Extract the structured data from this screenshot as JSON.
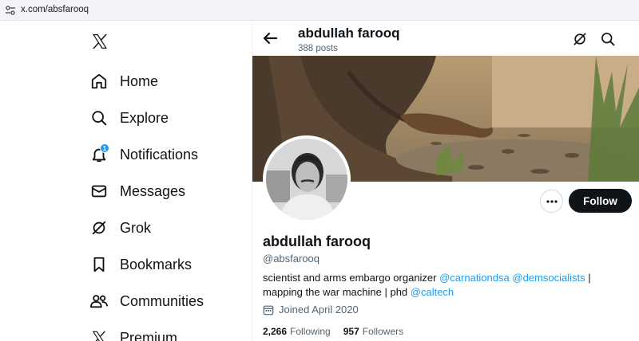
{
  "browser": {
    "url": "x.com/absfarooq"
  },
  "nav": {
    "items": [
      {
        "label": "Home",
        "icon": "home-icon"
      },
      {
        "label": "Explore",
        "icon": "search-icon"
      },
      {
        "label": "Notifications",
        "icon": "bell-icon",
        "badge": "1"
      },
      {
        "label": "Messages",
        "icon": "envelope-icon"
      },
      {
        "label": "Grok",
        "icon": "grok-icon"
      },
      {
        "label": "Bookmarks",
        "icon": "bookmark-icon"
      },
      {
        "label": "Communities",
        "icon": "people-icon"
      },
      {
        "label": "Premium",
        "icon": "x-logo-icon"
      }
    ]
  },
  "header": {
    "title": "abdullah farooq",
    "posts": "388 posts"
  },
  "profile": {
    "name": "abdullah farooq",
    "handle": "@absfarooq",
    "bio": {
      "text1": "scientist and arms embargo organizer ",
      "link1": "@carnationdsa",
      "text2": " ",
      "link2": "@demsocialists",
      "text3": " | mapping the war machine | phd ",
      "link3": "@caltech"
    },
    "joined": "Joined April 2020",
    "following_count": "2,266",
    "following_label": "Following",
    "followers_count": "957",
    "followers_label": "Followers",
    "follow_button": "Follow"
  },
  "colors": {
    "accent": "#1d9bf0",
    "text": "#0f1419",
    "muted": "#536471",
    "follow_bg": "#0f1419"
  }
}
